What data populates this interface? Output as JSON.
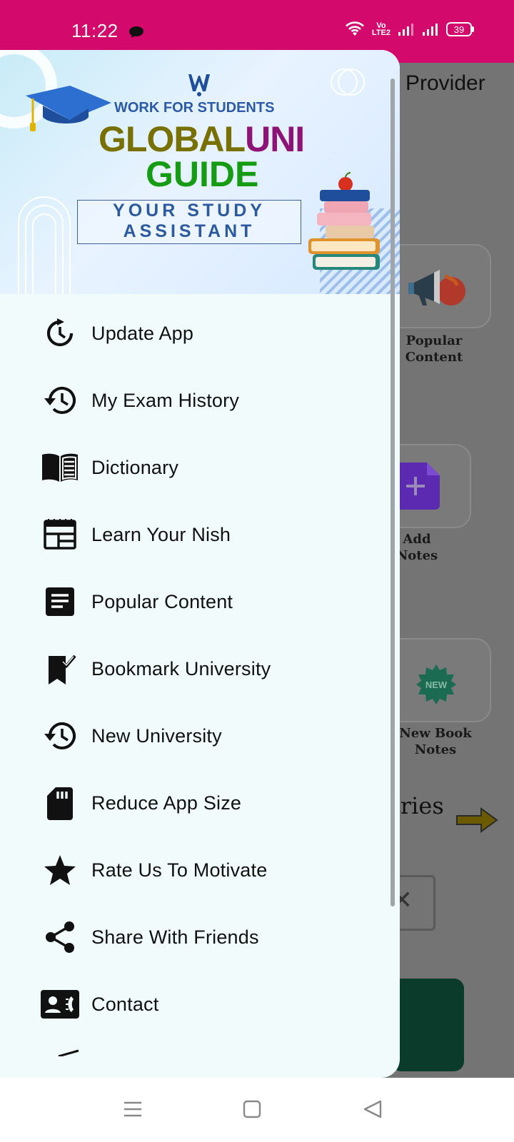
{
  "status_bar": {
    "time": "11:22",
    "battery": "39",
    "network_badge": "Vo\nLTE2",
    "bg_color": "#d30a6c"
  },
  "background_screen": {
    "title_partial": "Provider",
    "cards": [
      {
        "label_line1": "Popular",
        "label_line2": "Content",
        "icon": "megaphone-icon"
      },
      {
        "label_line1": "Add",
        "label_line2": "Notes",
        "icon": "add-note-icon"
      },
      {
        "label_line1": "New Book",
        "label_line2": "Notes",
        "icon": "new-badge-icon",
        "badge_text": "NEW"
      }
    ],
    "section_partial": "tries"
  },
  "drawer": {
    "banner": {
      "tag": "WORK FOR STUDENTS",
      "name_part1": "GLOBAL",
      "name_part2": "UNI",
      "name_line2": "GUIDE",
      "tagline_line1": "YOUR STUDY",
      "tagline_line2": "ASSISTANT"
    },
    "items": [
      {
        "label": "Update App",
        "icon": "update-icon"
      },
      {
        "label": "My Exam History",
        "icon": "history-icon"
      },
      {
        "label": "Dictionary",
        "icon": "book-icon"
      },
      {
        "label": "Learn Your Nish",
        "icon": "calendar-icon"
      },
      {
        "label": "Popular Content",
        "icon": "article-icon"
      },
      {
        "label": "Bookmark University",
        "icon": "bookmark-icon"
      },
      {
        "label": "New University",
        "icon": "history-icon"
      },
      {
        "label": "Reduce App Size",
        "icon": "sd-card-icon"
      },
      {
        "label": "Rate Us To Motivate",
        "icon": "star-icon"
      },
      {
        "label": "Share With Friends",
        "icon": "share-icon"
      },
      {
        "label": "Contact",
        "icon": "contact-card-icon"
      }
    ]
  },
  "nav_bar": {
    "buttons": [
      "menu-icon",
      "home-icon",
      "back-icon"
    ]
  },
  "colors": {
    "accent": "#d30a6c",
    "drawer_bg": "#f2fbfb",
    "brand_olive": "#787000",
    "brand_purple": "#8e1377",
    "brand_green": "#159c12",
    "brand_blue": "#2c5aa8"
  }
}
